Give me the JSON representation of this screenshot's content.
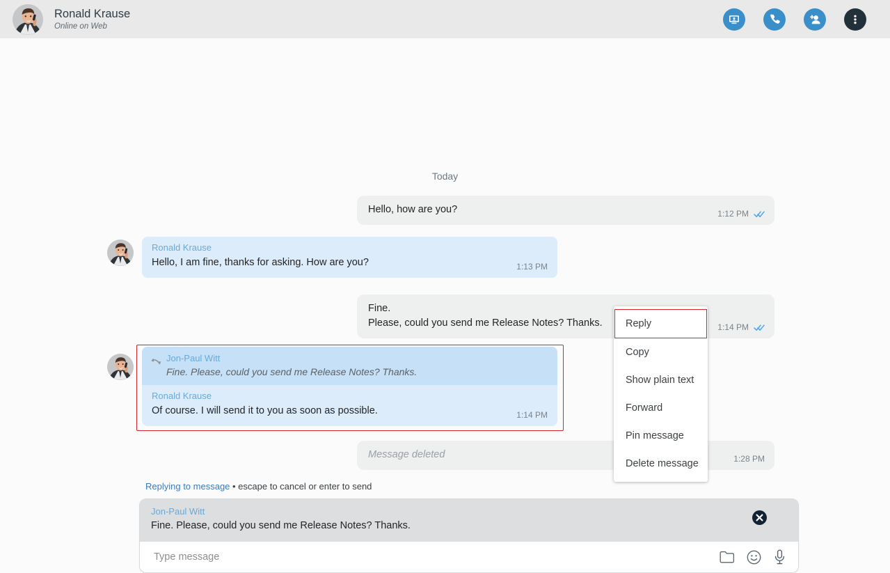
{
  "header": {
    "contact_name": "Ronald Krause",
    "status": "Online on Web",
    "avatar_alt": "contact-photo",
    "actions": [
      {
        "name": "screen-share-icon",
        "label": "Screen share"
      },
      {
        "name": "phone-icon",
        "label": "Call"
      },
      {
        "name": "add-person-icon",
        "label": "Add participant"
      },
      {
        "name": "more-options-icon",
        "label": "More options"
      }
    ],
    "accent_color": "#3a8fc8",
    "dark_color": "#22303a"
  },
  "conversation": {
    "day_divider": "Today",
    "messages": [
      {
        "id": "m1",
        "direction": "out",
        "text": "Hello, how are you?",
        "time": "1:12 PM",
        "read": true
      },
      {
        "id": "m2",
        "direction": "in",
        "sender": "Ronald Krause",
        "text": "Hello, I am fine, thanks for asking. How are you?",
        "time": "1:13 PM",
        "read": false
      },
      {
        "id": "m3",
        "direction": "out",
        "text": "Fine.\nPlease, could you send me Release Notes? Thanks.",
        "time": "1:14 PM",
        "read": true
      },
      {
        "id": "m4",
        "direction": "in",
        "sender": "Ronald Krause",
        "text": "Of course. I will send it to you as soon as possible.",
        "time": "1:14 PM",
        "read": false,
        "quote": {
          "sender": "Jon-Paul Witt",
          "text": "Fine. Please, could you send me Release Notes? Thanks."
        },
        "highlighted": true
      },
      {
        "id": "m5",
        "direction": "out",
        "text": "Message deleted",
        "time": "1:28 PM",
        "read": false,
        "deleted": true
      }
    ]
  },
  "context_menu": {
    "items": [
      {
        "label": "Reply",
        "selected": true
      },
      {
        "label": "Copy",
        "selected": false
      },
      {
        "label": "Show plain text",
        "selected": false
      },
      {
        "label": "Forward",
        "selected": false
      },
      {
        "label": "Pin message",
        "selected": false
      },
      {
        "label": "Delete message",
        "selected": false
      }
    ],
    "selection_color": "#d8232a"
  },
  "composer": {
    "reply_hint_link": "Replying to message",
    "reply_hint_rest": " • escape to cancel or enter to send",
    "quote_sender": "Jon-Paul Witt",
    "quote_text": "Fine. Please, could you send me Release Notes? Thanks.",
    "close_label": "Cancel reply",
    "input_value": "",
    "input_placeholder": "Type message",
    "icons": [
      {
        "name": "attach-folder-icon",
        "label": "Attach file"
      },
      {
        "name": "emoji-icon",
        "label": "Insert emoji"
      },
      {
        "name": "microphone-icon",
        "label": "Record voice message"
      }
    ]
  }
}
